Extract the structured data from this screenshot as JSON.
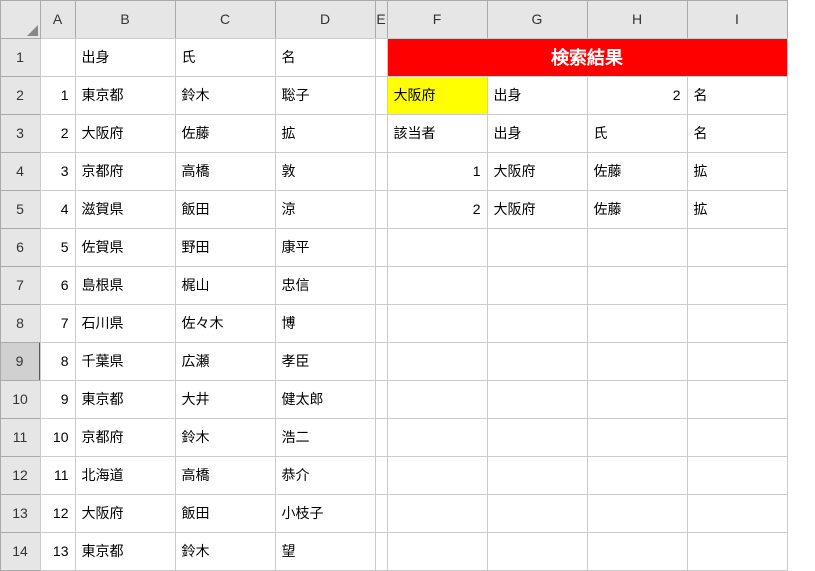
{
  "columns": [
    "A",
    "B",
    "C",
    "D",
    "E",
    "F",
    "G",
    "H",
    "I"
  ],
  "rowNumbers": [
    "1",
    "2",
    "3",
    "4",
    "5",
    "6",
    "7",
    "8",
    "9",
    "10",
    "11",
    "12",
    "13",
    "14"
  ],
  "selectedRow": 9,
  "left": {
    "header": {
      "b": "出身",
      "c": "氏",
      "d": "名"
    },
    "rows": [
      {
        "a": "1",
        "b": "東京都",
        "c": "鈴木",
        "d": "聡子"
      },
      {
        "a": "2",
        "b": "大阪府",
        "c": "佐藤",
        "d": "拡"
      },
      {
        "a": "3",
        "b": "京都府",
        "c": "高橋",
        "d": "敦"
      },
      {
        "a": "4",
        "b": "滋賀県",
        "c": "飯田",
        "d": "涼"
      },
      {
        "a": "5",
        "b": "佐賀県",
        "c": "野田",
        "d": "康平"
      },
      {
        "a": "6",
        "b": "島根県",
        "c": "梶山",
        "d": "忠信"
      },
      {
        "a": "7",
        "b": "石川県",
        "c": "佐々木",
        "d": "博"
      },
      {
        "a": "8",
        "b": "千葉県",
        "c": "広瀬",
        "d": "孝臣"
      },
      {
        "a": "9",
        "b": "東京都",
        "c": "大井",
        "d": "健太郎"
      },
      {
        "a": "10",
        "b": "京都府",
        "c": "鈴木",
        "d": "浩二"
      },
      {
        "a": "11",
        "b": "北海道",
        "c": "高橋",
        "d": "恭介"
      },
      {
        "a": "12",
        "b": "大阪府",
        "c": "飯田",
        "d": "小枝子"
      },
      {
        "a": "13",
        "b": "東京都",
        "c": "鈴木",
        "d": "望"
      }
    ]
  },
  "right": {
    "title": "検索結果",
    "row2": {
      "f": "大阪府",
      "g": "出身",
      "h": "2",
      "i": "名"
    },
    "row3": {
      "f": "該当者",
      "g": "出身",
      "h": "氏",
      "i": "名"
    },
    "results": [
      {
        "f": "1",
        "g": "大阪府",
        "h": "佐藤",
        "i": "拡"
      },
      {
        "f": "2",
        "g": "大阪府",
        "h": "佐藤",
        "i": "拡"
      }
    ]
  }
}
